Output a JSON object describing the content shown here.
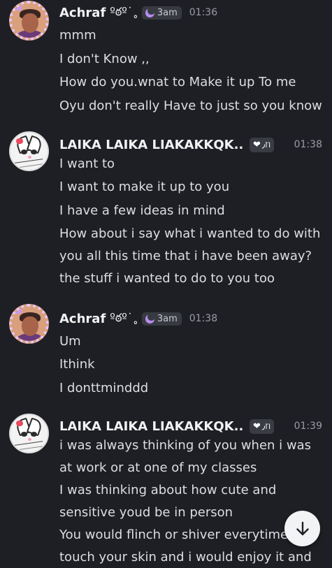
{
  "messages": [
    {
      "author": "Achraf",
      "decor": "ºఠº˙˳",
      "tag": "3am",
      "time": "01:36",
      "lines": [
        "mmm",
        "I don't Know ,,",
        "How do you.wnat to Make it up To me",
        "Oyu don't really Have to just so you know"
      ]
    },
    {
      "author": "LAIKA LAIKA LIAKAKKQK...",
      "tag": "٫ᥒ",
      "time": "01:38",
      "lines": [
        "I want to",
        "I want to make it up to you",
        "I have a few ideas in mind",
        "How about i say what i wanted to do with you all this time that i have been away?",
        "the stuff i wanted to do to you too"
      ]
    },
    {
      "author": "Achraf",
      "decor": "ºఠº˙˳",
      "tag": "3am",
      "time": "01:38",
      "lines": [
        "Um",
        "Ithink",
        "I donttminddd"
      ]
    },
    {
      "author": "LAIKA LAIKA LIAKAKKQK...",
      "tag": "٫ᥒ",
      "time": "01:39",
      "lines": [
        "i was always thinking of you when i was at work or at one of my classes",
        "I was thinking about how cute and sensitive youd be in person",
        "You would flinch or shiver everytime touch your skin and i would enjoy it and"
      ]
    }
  ],
  "scroll_button": {
    "icon": "arrow-down-icon"
  },
  "colors": {
    "background": "#1e1f24",
    "text": "#dcdee3",
    "username": "#f2f3f5",
    "timestamp": "#9a9ca5",
    "moon": "#b98cf0"
  }
}
